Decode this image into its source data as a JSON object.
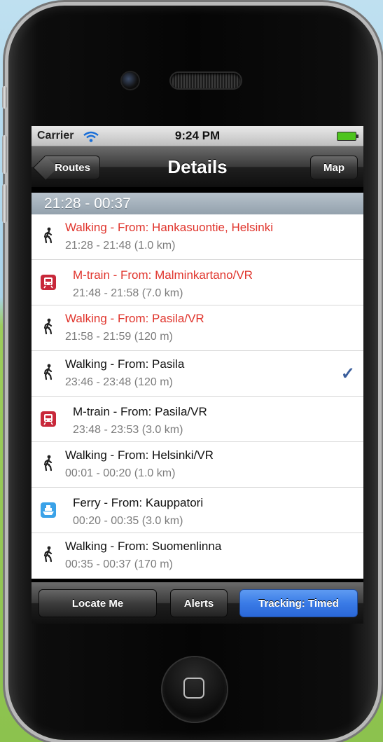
{
  "status_bar": {
    "carrier": "Carrier",
    "time": "9:24 PM"
  },
  "nav": {
    "back_label": "Routes",
    "title": "Details",
    "right_label": "Map"
  },
  "section": {
    "time_range": "21:28 - 00:37"
  },
  "legs": [
    {
      "title": "Walking - From: Hankasuontie, Helsinki",
      "subtitle": "21:28 - 21:48  (1.0 km)",
      "icon": "walking-icon",
      "active": true
    },
    {
      "title": "M-train - From: Malminkartano/VR",
      "subtitle": "21:48 - 21:58  (7.0 km)",
      "icon": "train-icon",
      "active": true
    },
    {
      "title": "Walking - From: Pasila/VR",
      "subtitle": "21:58 - 21:59  (120 m)",
      "icon": "walking-icon",
      "active": true
    },
    {
      "title": "Walking - From: Pasila",
      "subtitle": "23:46 - 23:48  (120 m)",
      "icon": "walking-icon",
      "checked": true
    },
    {
      "title": "M-train - From: Pasila/VR",
      "subtitle": "23:48 - 23:53  (3.0 km)",
      "icon": "train-icon"
    },
    {
      "title": "Walking - From: Helsinki/VR",
      "subtitle": "00:01 - 00:20  (1.0 km)",
      "icon": "walking-icon"
    },
    {
      "title": "Ferry - From: Kauppatori",
      "subtitle": "00:20 - 00:35  (3.0 km)",
      "icon": "ferry-icon"
    },
    {
      "title": "Walking - From: Suomenlinna",
      "subtitle": "00:35 - 00:37  (170 m)",
      "icon": "walking-icon"
    }
  ],
  "toolbar": {
    "locate_label": "Locate Me",
    "alerts_label": "Alerts",
    "tracking_label": "Tracking: Timed"
  },
  "colors": {
    "active_text": "#e0342c",
    "train_icon": "#c8283a",
    "ferry_icon": "#3aa2e8",
    "check": "#3a5e9c",
    "tracking_button": "#3a7be6"
  }
}
